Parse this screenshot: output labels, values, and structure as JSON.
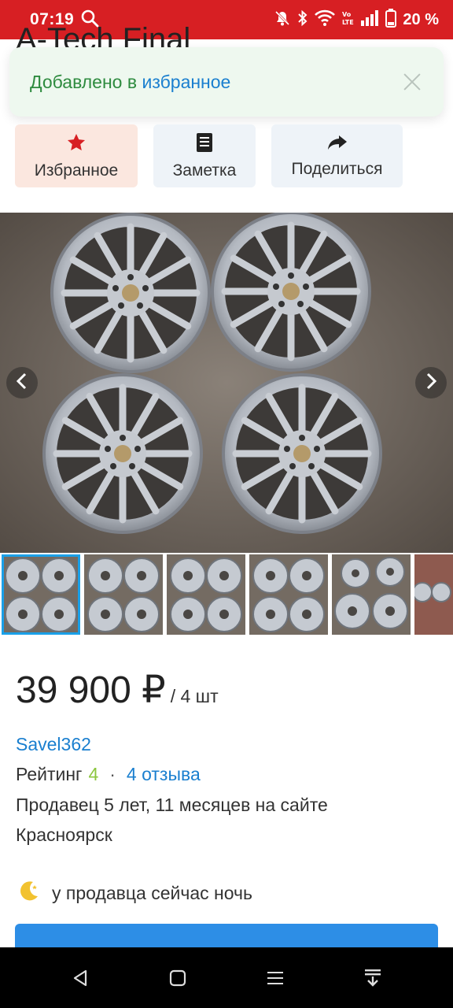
{
  "status_bar": {
    "time": "07:19",
    "battery_percent": "20 %",
    "icons": [
      "search-icon",
      "mute-icon",
      "bluetooth-icon",
      "wifi-icon",
      "volte-icon",
      "signal-icon",
      "battery-icon"
    ]
  },
  "page_title": "A-Tech Final",
  "toast": {
    "prefix": "Добавлено в ",
    "link": "избранное"
  },
  "actions": [
    {
      "label": "Избранное",
      "icon": "star-icon"
    },
    {
      "label": "Заметка",
      "icon": "note-icon"
    },
    {
      "label": "Поделиться",
      "icon": "share-icon"
    }
  ],
  "gallery": {
    "photo_description_icon": "wheels-photo",
    "thumbnail_count": 6
  },
  "listing": {
    "price": "39 900 ₽",
    "price_unit": "/ 4 шт",
    "seller_name": "Savel362",
    "rating_label": "Рейтинг",
    "rating_value": "4",
    "rating_separator": "·",
    "reviews": "4 отзыва",
    "seller_since": "Продавец 5 лет, 11 месяцев на сайте",
    "city": "Красноярск",
    "night_notice": "у продавца сейчас ночь"
  },
  "primary_button": {
    "label": ""
  },
  "colors": {
    "status_bar": "#d71f23",
    "link": "#1a7fcf",
    "rating": "#8cc63f",
    "toast_green": "#2e8b3f",
    "primary": "#2d8ee6",
    "star": "#d71f23"
  }
}
